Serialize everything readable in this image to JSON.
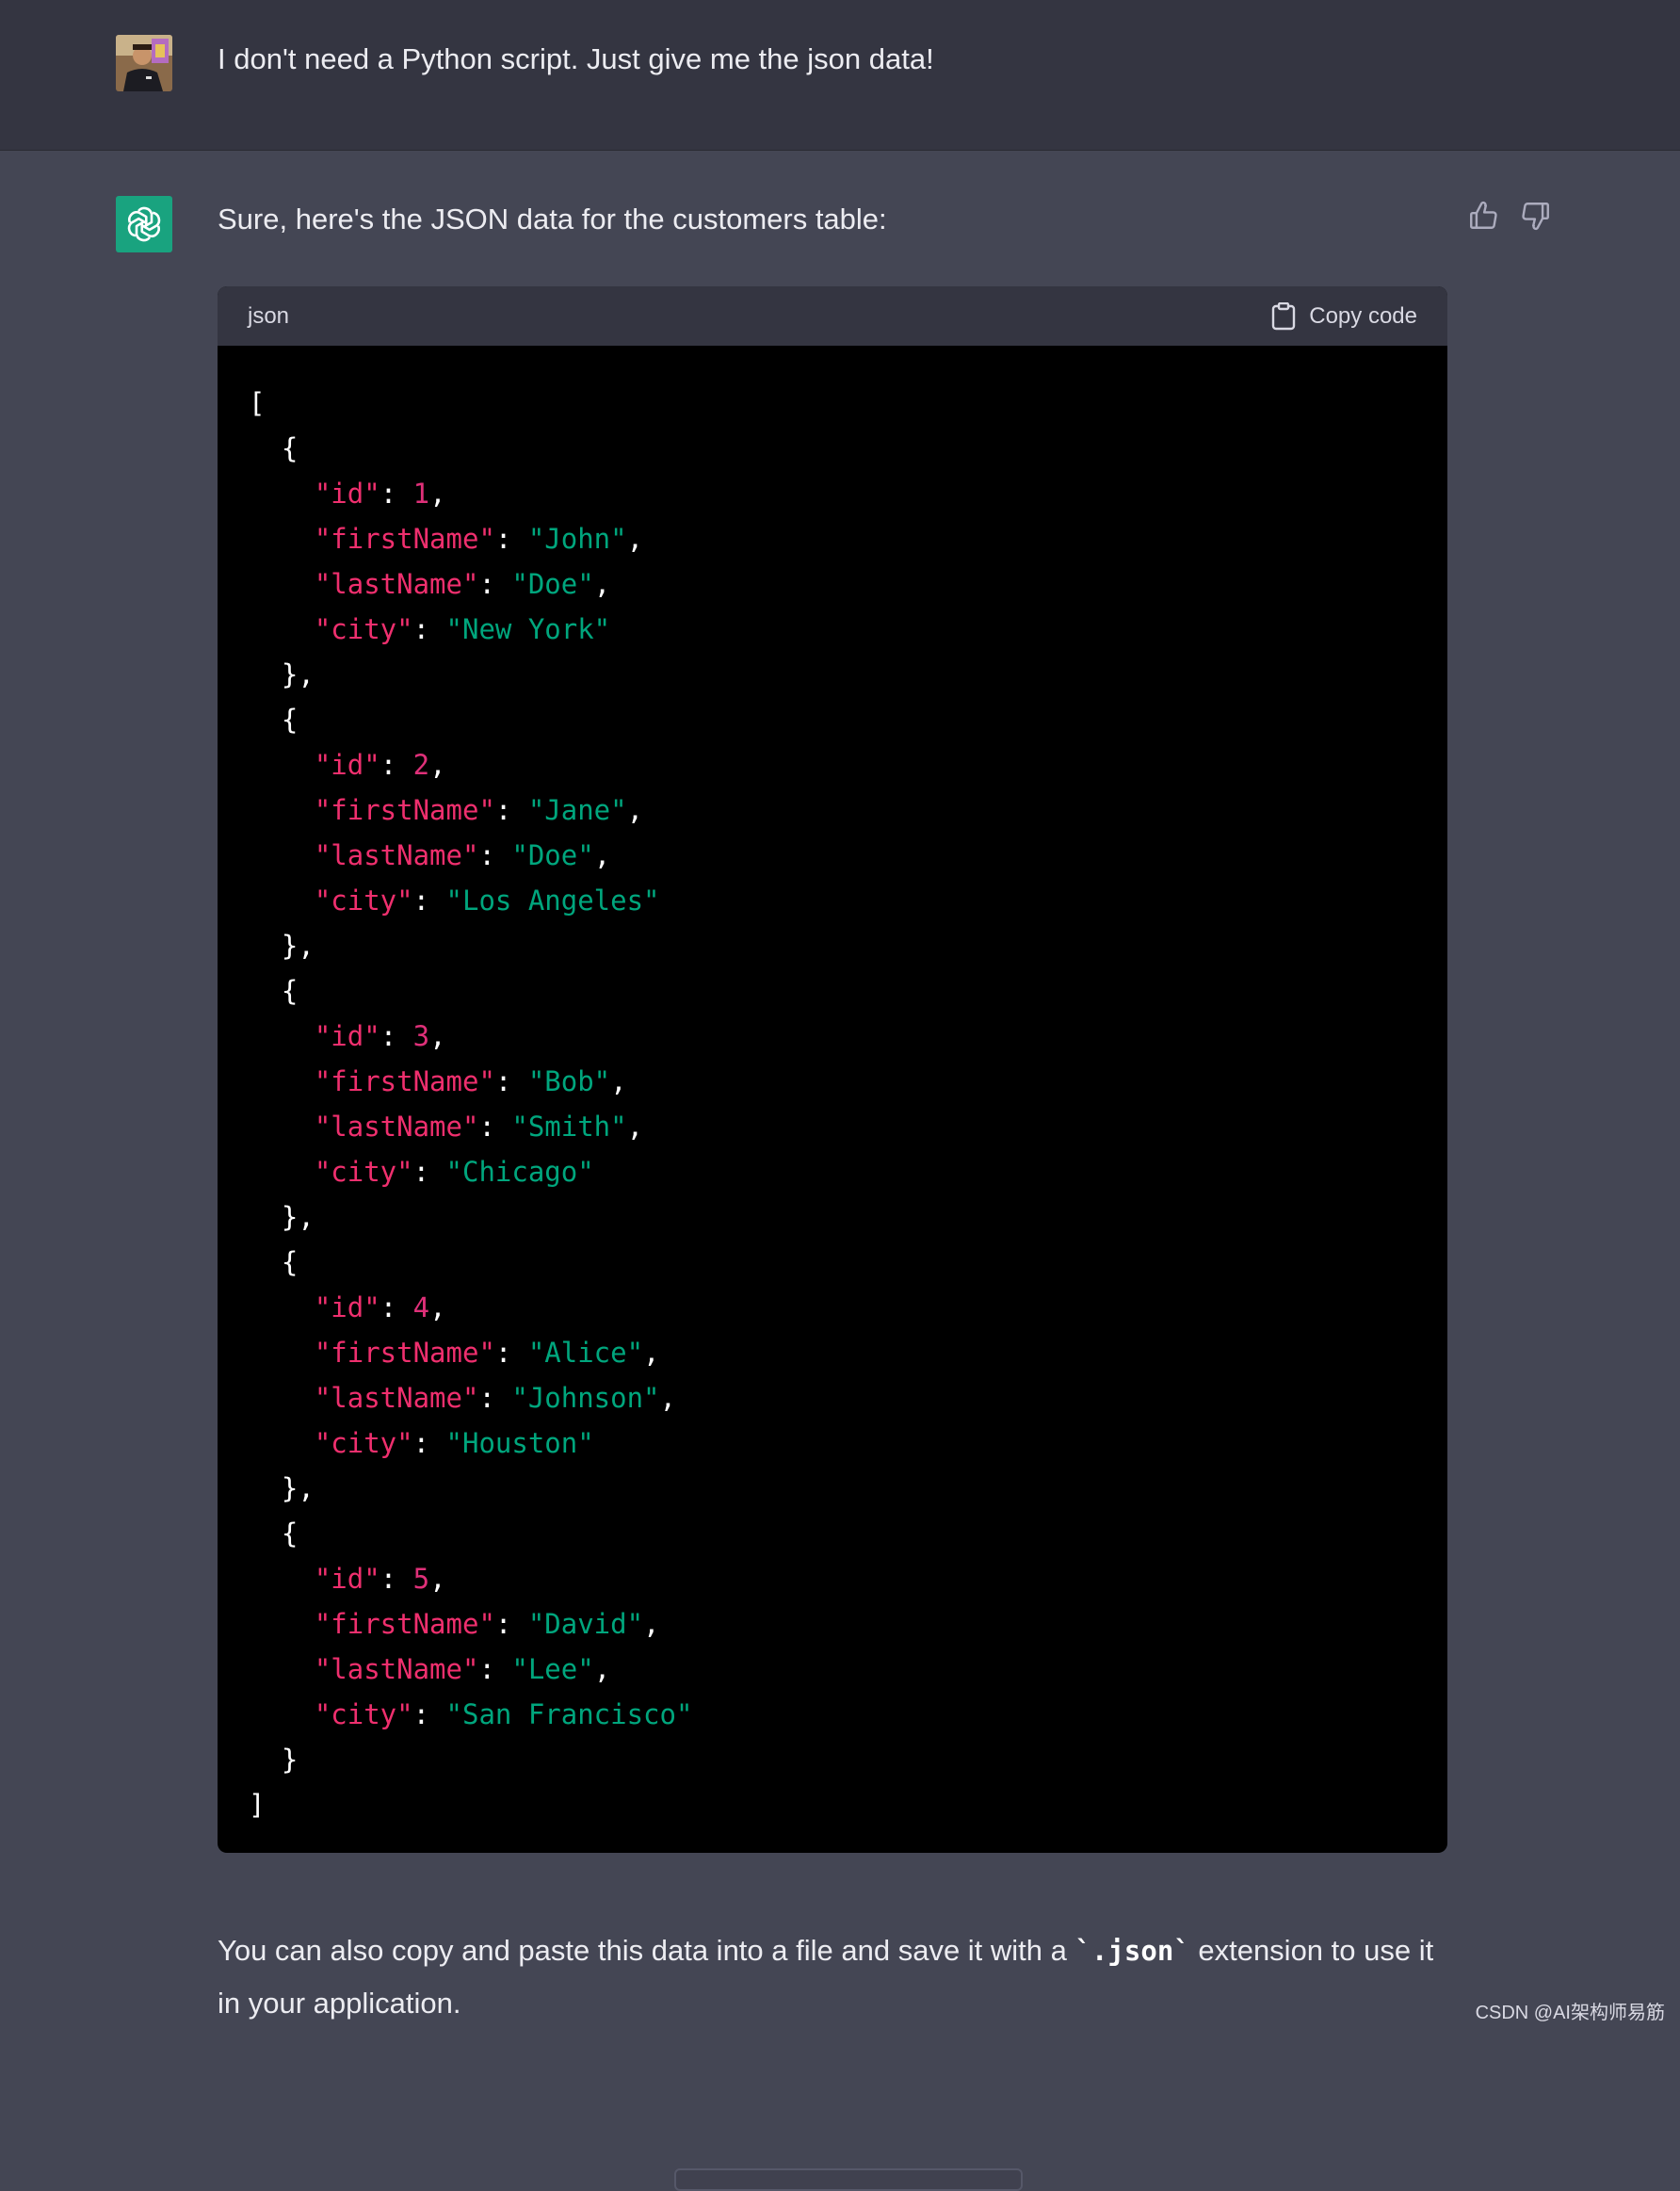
{
  "user_message": {
    "text": "I don't need a Python script. Just give me the json data!"
  },
  "assistant_message": {
    "intro": "Sure, here's the JSON data for the customers table:",
    "code_block": {
      "language": "json",
      "copy_label": "Copy code",
      "customers": [
        {
          "id": 1,
          "firstName": "John",
          "lastName": "Doe",
          "city": "New York"
        },
        {
          "id": 2,
          "firstName": "Jane",
          "lastName": "Doe",
          "city": "Los Angeles"
        },
        {
          "id": 3,
          "firstName": "Bob",
          "lastName": "Smith",
          "city": "Chicago"
        },
        {
          "id": 4,
          "firstName": "Alice",
          "lastName": "Johnson",
          "city": "Houston"
        },
        {
          "id": 5,
          "firstName": "David",
          "lastName": "Lee",
          "city": "San Francisco"
        }
      ]
    },
    "followup": {
      "before": "You can also copy and paste this data into a file and save it with a ",
      "code": "`.json`",
      "after": " extension to use it in your application."
    }
  },
  "watermark": "CSDN @AI架构师易筋",
  "icons": {
    "user_avatar": "user-avatar-photo",
    "assistant_avatar": "openai-logo-icon",
    "thumbs_up": "thumbs-up-icon",
    "thumbs_down": "thumbs-down-icon",
    "copy": "clipboard-icon"
  },
  "colors": {
    "user_row_bg": "#343541",
    "assistant_row_bg": "#444654",
    "code_bg": "#000000",
    "code_header_bg": "#343541",
    "json_key": "#ef2f6e",
    "json_string": "#00a67d",
    "json_number": "#df3079",
    "brand_green": "#19a37f"
  }
}
